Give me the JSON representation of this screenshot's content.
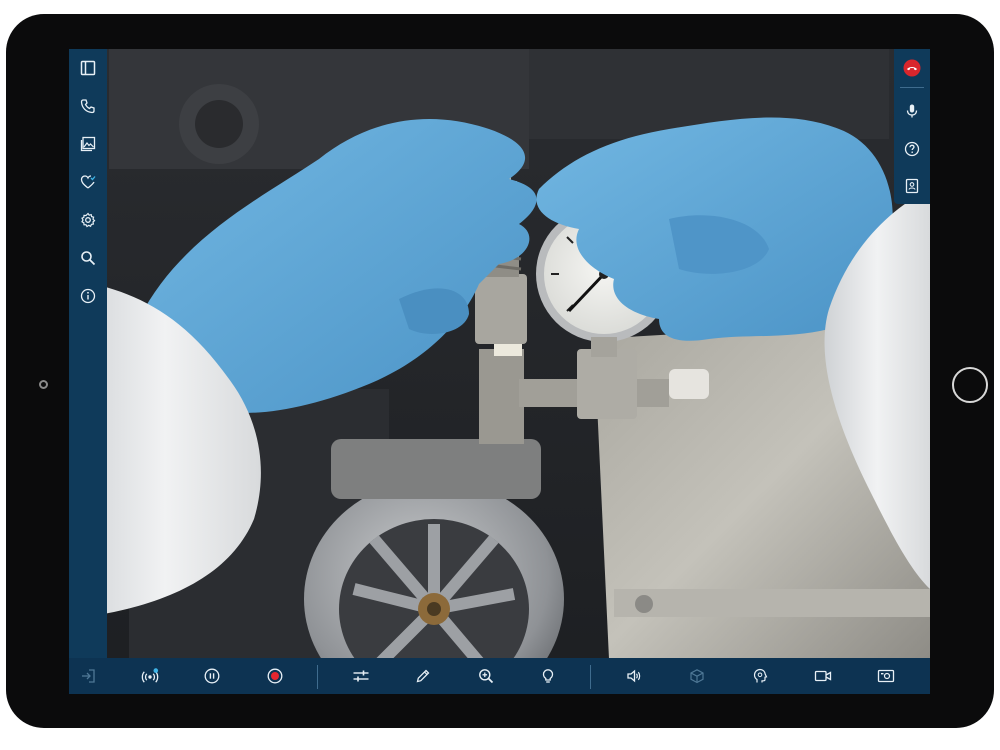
{
  "app": {
    "colors": {
      "rail": "#0f3a5a",
      "bar": "#0d3352",
      "icon": "#e8f0f6",
      "icon_disabled": "#4f7896",
      "hangup": "#d9262c",
      "record": "#e5262f",
      "live_badge": "#3fb4e6",
      "glove": "#5aa6d8"
    }
  },
  "left_toolbar": [
    {
      "icon": "sidebar-panel-icon"
    },
    {
      "icon": "phone-icon"
    },
    {
      "icon": "gallery-icon"
    },
    {
      "icon": "health-check-icon"
    },
    {
      "icon": "gear-icon"
    },
    {
      "icon": "search-icon"
    },
    {
      "icon": "info-icon"
    }
  ],
  "right_toolbar": [
    {
      "icon": "hang-up-icon"
    },
    {
      "icon": "microphone-icon"
    },
    {
      "icon": "help-icon"
    },
    {
      "icon": "contacts-icon"
    }
  ],
  "bottom_toolbar": [
    {
      "icon": "exit-icon",
      "enabled": false
    },
    {
      "icon": "live-broadcast-icon",
      "enabled": true
    },
    {
      "icon": "pause-icon",
      "enabled": true
    },
    {
      "icon": "record-icon",
      "enabled": true
    },
    {
      "icon": "adjust-sliders-icon",
      "enabled": true
    },
    {
      "icon": "pencil-icon",
      "enabled": true
    },
    {
      "icon": "zoom-in-icon",
      "enabled": true
    },
    {
      "icon": "light-bulb-icon",
      "enabled": true
    },
    {
      "icon": "volume-icon",
      "enabled": true
    },
    {
      "icon": "3d-box-icon",
      "enabled": false
    },
    {
      "icon": "assistant-icon",
      "enabled": true
    },
    {
      "icon": "video-camera-icon",
      "enabled": true
    },
    {
      "icon": "screen-capture-icon",
      "enabled": true
    }
  ]
}
